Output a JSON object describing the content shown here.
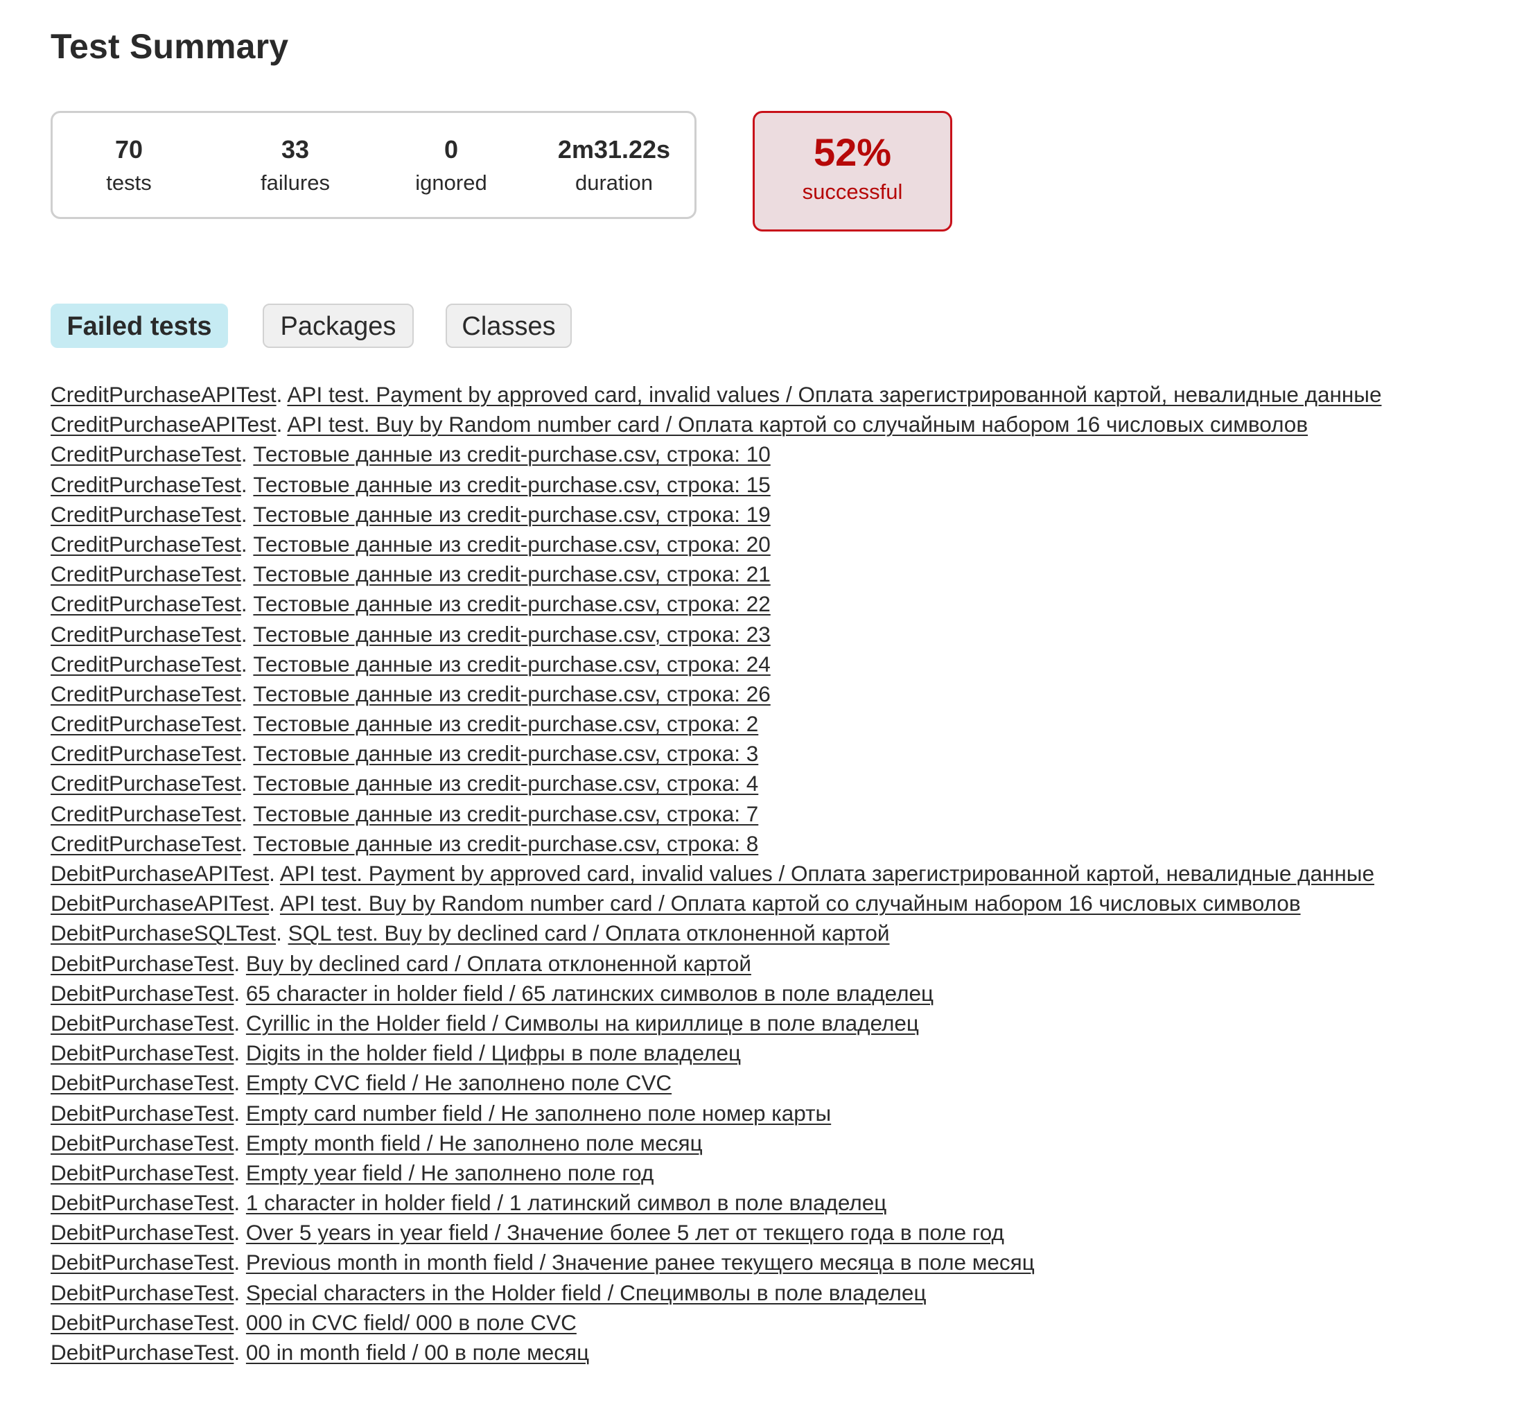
{
  "page": {
    "title": "Test Summary"
  },
  "summary": {
    "tests": {
      "value": "70",
      "label": "tests"
    },
    "failures": {
      "value": "33",
      "label": "failures"
    },
    "ignored": {
      "value": "0",
      "label": "ignored"
    },
    "duration": {
      "value": "2m31.22s",
      "label": "duration"
    },
    "success_rate": {
      "value": "52%",
      "label": "successful"
    }
  },
  "tabs": [
    {
      "label": "Failed tests",
      "active": true
    },
    {
      "label": "Packages",
      "active": false
    },
    {
      "label": "Classes",
      "active": false
    }
  ],
  "failed_tests": [
    {
      "class": "CreditPurchaseAPITest",
      "test": "API test. Payment by approved card, invalid values / Оплата зарегистрированной картой, невалидные данные"
    },
    {
      "class": "CreditPurchaseAPITest",
      "test": "API test. Buy by Random number card / Оплата картой со случайным набором 16 числовых символов"
    },
    {
      "class": "CreditPurchaseTest",
      "test": "Тестовые данные из credit-purchase.csv, строка: 10"
    },
    {
      "class": "CreditPurchaseTest",
      "test": "Тестовые данные из credit-purchase.csv, строка: 15"
    },
    {
      "class": "CreditPurchaseTest",
      "test": "Тестовые данные из credit-purchase.csv, строка: 19"
    },
    {
      "class": "CreditPurchaseTest",
      "test": "Тестовые данные из credit-purchase.csv, строка: 20"
    },
    {
      "class": "CreditPurchaseTest",
      "test": "Тестовые данные из credit-purchase.csv, строка: 21"
    },
    {
      "class": "CreditPurchaseTest",
      "test": "Тестовые данные из credit-purchase.csv, строка: 22"
    },
    {
      "class": "CreditPurchaseTest",
      "test": "Тестовые данные из credit-purchase.csv, строка: 23"
    },
    {
      "class": "CreditPurchaseTest",
      "test": "Тестовые данные из credit-purchase.csv, строка: 24"
    },
    {
      "class": "CreditPurchaseTest",
      "test": "Тестовые данные из credit-purchase.csv, строка: 26"
    },
    {
      "class": "CreditPurchaseTest",
      "test": "Тестовые данные из credit-purchase.csv, строка: 2"
    },
    {
      "class": "CreditPurchaseTest",
      "test": "Тестовые данные из credit-purchase.csv, строка: 3"
    },
    {
      "class": "CreditPurchaseTest",
      "test": "Тестовые данные из credit-purchase.csv, строка: 4"
    },
    {
      "class": "CreditPurchaseTest",
      "test": "Тестовые данные из credit-purchase.csv, строка: 7"
    },
    {
      "class": "CreditPurchaseTest",
      "test": "Тестовые данные из credit-purchase.csv, строка: 8"
    },
    {
      "class": "DebitPurchaseAPITest",
      "test": "API test. Payment by approved card, invalid values / Оплата зарегистрированной картой, невалидные данные"
    },
    {
      "class": "DebitPurchaseAPITest",
      "test": "API test. Buy by Random number card / Оплата картой со случайным набором 16 числовых символов"
    },
    {
      "class": "DebitPurchaseSQLTest",
      "test": "SQL test. Buy by declined card / Оплата отклоненной картой"
    },
    {
      "class": "DebitPurchaseTest",
      "test": "Buy by declined card / Оплата отклоненной картой"
    },
    {
      "class": "DebitPurchaseTest",
      "test": "65 character in holder field / 65 латинских символов в поле владелец"
    },
    {
      "class": "DebitPurchaseTest",
      "test": "Cyrillic in the Holder field / Символы на кириллице в поле владелец"
    },
    {
      "class": "DebitPurchaseTest",
      "test": "Digits in the holder field / Цифры в поле владелец"
    },
    {
      "class": "DebitPurchaseTest",
      "test": "Empty CVC field / Не заполнено поле CVC"
    },
    {
      "class": "DebitPurchaseTest",
      "test": "Empty card number field / Не заполнено поле номер карты"
    },
    {
      "class": "DebitPurchaseTest",
      "test": "Empty month field / Не заполнено поле месяц"
    },
    {
      "class": "DebitPurchaseTest",
      "test": "Empty year field / Не заполнено поле год"
    },
    {
      "class": "DebitPurchaseTest",
      "test": "1 character in holder field / 1 латинский символ в поле владелец"
    },
    {
      "class": "DebitPurchaseTest",
      "test": "Over 5 years in year field / Значение более 5 лет от текщего года в поле год"
    },
    {
      "class": "DebitPurchaseTest",
      "test": "Previous month in month field / Значение ранее текущего месяца в поле месяц"
    },
    {
      "class": "DebitPurchaseTest",
      "test": "Special characters in the Holder field / Специмволы в поле владелец"
    },
    {
      "class": "DebitPurchaseTest",
      "test": "000 in CVC field/ 000 в поле CVC"
    },
    {
      "class": "DebitPurchaseTest",
      "test": "00 in month field / 00 в поле месяц"
    }
  ],
  "colors": {
    "text": "#2a2a2a",
    "failure_red": "#b60808",
    "failure_bg": "#ecdcdf",
    "active_tab_bg": "#c6ebf3",
    "inactive_tab_bg": "#f0f0f0"
  }
}
